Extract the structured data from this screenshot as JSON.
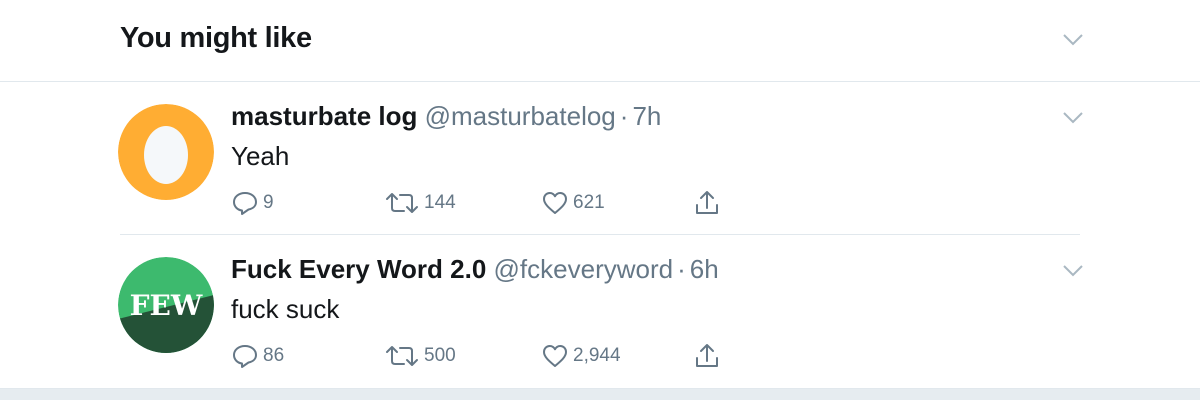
{
  "header": {
    "title": "You might like"
  },
  "tweets": [
    {
      "name": "masturbate log",
      "handle": "@masturbatelog",
      "separator": "·",
      "time": "7h",
      "text": "Yeah",
      "replies": "9",
      "retweets": "144",
      "likes": "621",
      "avatar": {
        "type": "egg",
        "bg": "#ffad33",
        "egg": "#f5f8fa"
      }
    },
    {
      "name": "Fuck Every Word 2.0",
      "handle": "@fckeveryword",
      "separator": "·",
      "time": "6h",
      "text": "fuck suck",
      "replies": "86",
      "retweets": "500",
      "likes": "2,944",
      "avatar": {
        "type": "logo",
        "logo_text": "FEW",
        "bg_top": "#3dba6e",
        "bg_bottom": "#245237"
      }
    }
  ],
  "colors": {
    "accent": "#1da1f2",
    "text": "#14171a",
    "muted": "#657786",
    "border": "#e1e8ed"
  }
}
